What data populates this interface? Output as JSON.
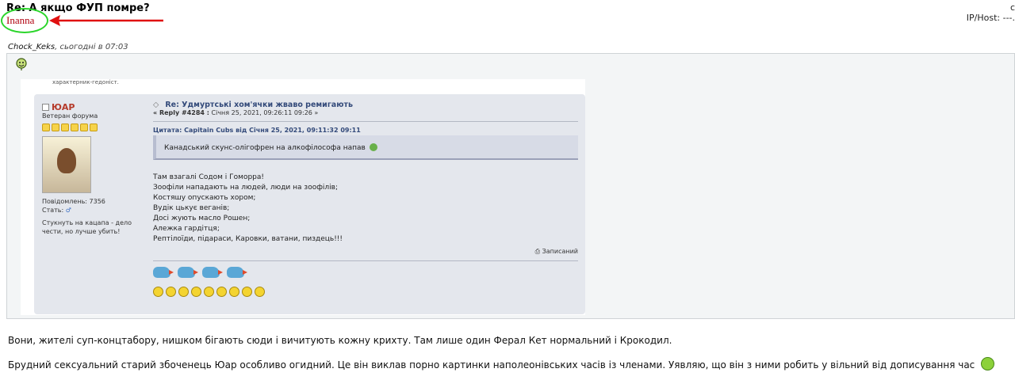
{
  "post": {
    "title": "Re: А якщо ФУП помре?",
    "author": "Inanna",
    "corner_text": "с",
    "iphost_label": "IP/Host:",
    "iphost_value": "---."
  },
  "quote": {
    "author": "Chock_Keks",
    "date": ", сьогодні в 07:03"
  },
  "screenshot": {
    "top_line": "характерник-гедоніст.",
    "poster": {
      "name": "ЮАР",
      "rank": "Ветеран форума",
      "posts": "Повідомлень: 7356",
      "gender_label": "Стать:",
      "gender_icon": "male-icon ♂",
      "signature": "Стукнуть на кацапа - дело чести, но лучше убить!"
    },
    "post_title": "Re: Удмуртські хом'ячки жваво ремигають",
    "reply_label": "« Reply #4284 :",
    "reply_date": "Січня 25, 2021, 09:26:11 09:26 »",
    "quote_label": "Цитата: Capitain Cubs від Січня 25, 2021, 09:11:32 09:11",
    "quote_text": "Канадський скунс-олігофрен на алкофілософа напав",
    "lines": [
      "Там взагалі Содом і Гоморра!",
      "Зоофіли нападають на людей, люди на зоофілів;",
      "Костяшу опускають хором;",
      "Вудік цькує веганів;",
      "Досі жують масло Рошен;",
      "Алежка гардітця;",
      "Рептілоїди, підараси, Каровки, ватани, пиздець!!!"
    ],
    "saved_label": "Записаний"
  },
  "body": {
    "para1": "Вони, жителі суп-концтабору, нишком бігають сюди і вичитують кожну крихту. Там лише один Ферал Кет нормальний і Крокодил.",
    "para2": "Брудний сексуальний старий збоченець Юар особливо огидний. Це він виклав порно картинки наполеонівських часів із членами. Уявляю, що він з ними робить у вільний від дописування час"
  },
  "colors": {
    "author": "#b0000e",
    "highlight_ellipse": "#2bd52b",
    "arrow": "#e01010"
  }
}
